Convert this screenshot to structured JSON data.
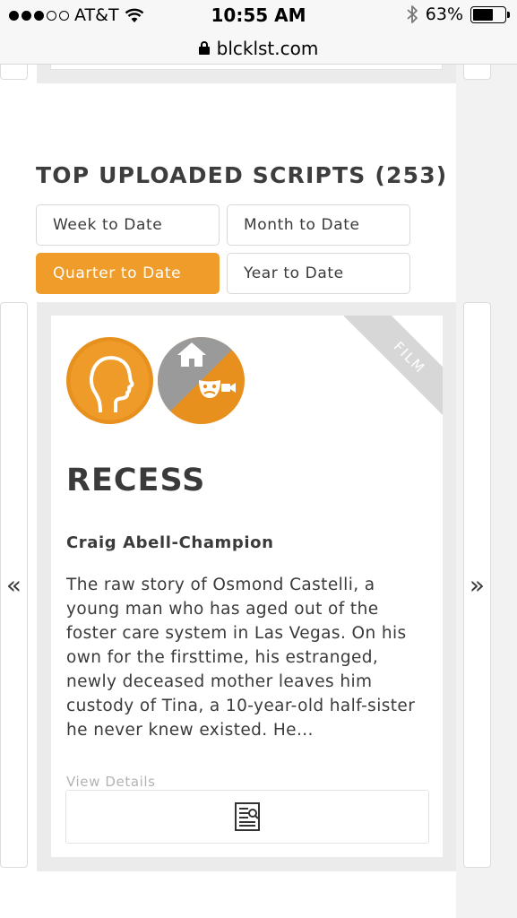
{
  "status_bar": {
    "carrier": "AT&T",
    "time": "10:55 AM",
    "battery": "63%",
    "battery_level": 0.63
  },
  "browser": {
    "url": "blcklst.com"
  },
  "section": {
    "title": "TOP UPLOADED SCRIPTS (253)"
  },
  "filters": {
    "week": "Week to Date",
    "month": "Month to Date",
    "quarter": "Quarter to Date",
    "year": "Year to Date",
    "active": "Quarter to Date"
  },
  "slider": {
    "prev": "«",
    "next": "»"
  },
  "card": {
    "ribbon": "FILM",
    "title": "RECESS",
    "author": "Craig Abell-Champion",
    "logline": "The raw story of Osmond Castelli, a young man who has aged out of the foster care system in Las Vegas. On his own for the firsttime, his estranged, newly deceased mother leaves him custody of Tina, a 10-year-old half-sister he never knew existed. He...",
    "view_details": "View Details",
    "genre_icons": [
      "character-profile-icon",
      "family-drama-icon"
    ]
  },
  "colors": {
    "accent": "#f09c2a",
    "icon_orange": "#e8901e",
    "icon_gray": "#9a9a9a",
    "text": "#3a3a3a"
  }
}
